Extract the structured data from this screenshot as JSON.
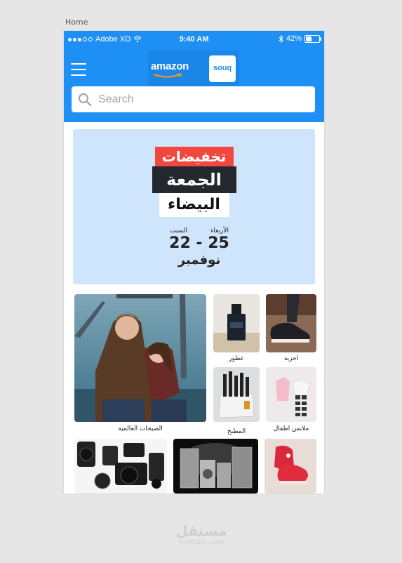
{
  "artboard_label": "Home",
  "status_bar": {
    "carrier": "Adobe XD",
    "time": "9:40 AM",
    "battery": "42%"
  },
  "header": {
    "amazon_logo": "amazon",
    "souq_logo": "souq"
  },
  "search": {
    "placeholder": "Search"
  },
  "banner": {
    "line1": "تخفيضات",
    "line2": "الجمعة",
    "line3": "البيضاء",
    "day_right": "الأربعاء",
    "day_left": "السبت",
    "date_range": "22 - 25",
    "month": "نوفمبر"
  },
  "categories": [
    {
      "label": "الصيحات العالمية"
    },
    {
      "label": "عطور"
    },
    {
      "label": "احزية"
    },
    {
      "label": "المطبخ"
    },
    {
      "label": "ملابس اطفال"
    }
  ],
  "watermark": {
    "arabic": "مستقل",
    "latin": "mostaql.com"
  }
}
